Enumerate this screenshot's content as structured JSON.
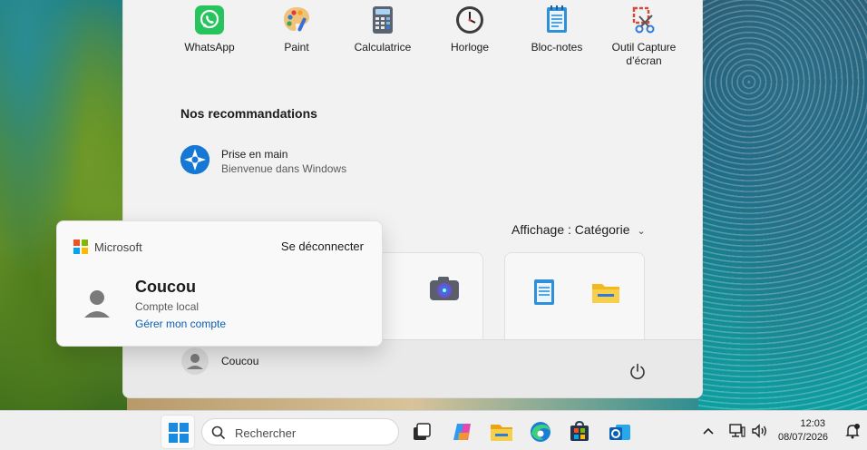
{
  "start_menu": {
    "pinned_apps": [
      {
        "label": "WhatsApp",
        "icon": "whatsapp-icon"
      },
      {
        "label": "Paint",
        "icon": "paint-palette-icon"
      },
      {
        "label": "Calculatrice",
        "icon": "calculator-icon"
      },
      {
        "label": "Horloge",
        "icon": "clock-icon"
      },
      {
        "label": "Bloc-notes",
        "icon": "notepad-icon"
      },
      {
        "label": "Outil Capture d’écran",
        "icon": "snipping-tool-icon"
      }
    ],
    "recommendations": {
      "title": "Nos recommandations",
      "items": [
        {
          "name": "Prise en main",
          "subtitle": "Bienvenue dans Windows",
          "icon": "get-started-icon"
        }
      ]
    },
    "view_selector": {
      "label": "Affichage : Catégorie"
    },
    "user": {
      "name": "Coucou"
    }
  },
  "account_flyout": {
    "brand": "Microsoft",
    "signout_label": "Se déconnecter",
    "name": "Coucou",
    "account_type": "Compte local",
    "manage_link": "Gérer mon compte"
  },
  "taskbar": {
    "search_placeholder": "Rechercher",
    "pinned": [
      "start-icon",
      "task-view-icon",
      "copilot-icon",
      "file-explorer-icon",
      "edge-icon",
      "store-icon",
      "outlook-icon"
    ],
    "clock": {
      "time": "12:03",
      "date": "08/07/2026"
    }
  },
  "colors": {
    "accent": "#0a5fb4",
    "start_bg": "#f2f2f2",
    "taskbar_bg": "#efefef"
  }
}
